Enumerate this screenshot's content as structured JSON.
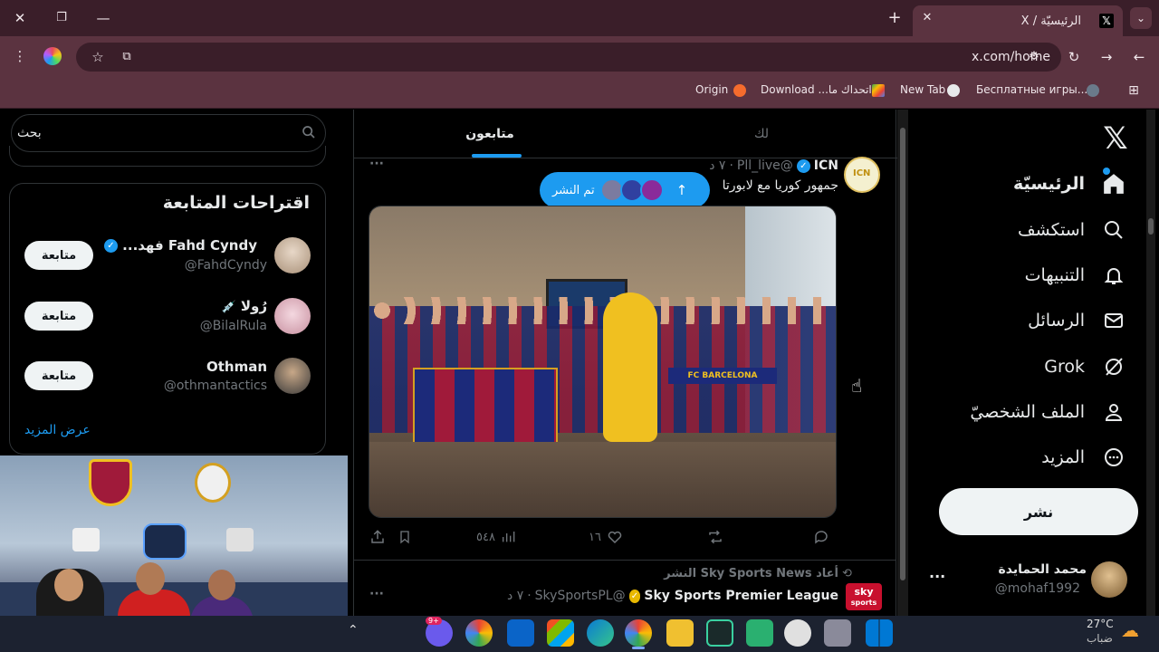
{
  "browser": {
    "tab_title": "الرئيسيّة / X",
    "url": "x.com/home",
    "bookmarks": [
      {
        "label": "Бесплатные игры..."
      },
      {
        "label": "New Tab"
      },
      {
        "label": "اتحداك ما... Download"
      },
      {
        "label": "Origin"
      }
    ]
  },
  "nav": {
    "items": [
      {
        "label": "الرئيسيّة",
        "icon": "home-icon"
      },
      {
        "label": "استكشف",
        "icon": "search-icon"
      },
      {
        "label": "التنبيهات",
        "icon": "bell-icon"
      },
      {
        "label": "الرسائل",
        "icon": "mail-icon"
      },
      {
        "label": "Grok",
        "icon": "grok-icon"
      },
      {
        "label": "الملف الشخصيّ",
        "icon": "person-icon"
      },
      {
        "label": "المزيد",
        "icon": "more-circle-icon"
      }
    ],
    "post_button": "نشر",
    "account_name": "محمد الحمايدة",
    "account_handle": "@mohaf1992"
  },
  "center": {
    "tabs": [
      {
        "label": "لك"
      },
      {
        "label": "متابعون"
      }
    ],
    "new_posts_pill": "تم النشر",
    "tweet1": {
      "author": "ICN",
      "handle": "@Pll_live",
      "time": "٧ د",
      "text": "جمهور كوريا مع لابورتا",
      "image_text": "FC BARCELONA",
      "views": "٥٤٨",
      "likes": "١٦"
    },
    "tweet2": {
      "repost_note": "أعاد Sky Sports News النشر",
      "author": "Sky Sports Premier League",
      "handle": "@SkySportsPL",
      "time": "٧ د",
      "avatar_text_top": "sky",
      "avatar_text_bottom": "sports"
    }
  },
  "right": {
    "search_placeholder": "بحث",
    "follow_title": "اقتراحات المتابعة",
    "suggestions": [
      {
        "name": "Fahd Cyndy فهد...",
        "handle": "@FahdCyndy",
        "button": "متابعة"
      },
      {
        "name": "رُولا",
        "handle": "@BilalRula",
        "button": "متابعة"
      },
      {
        "name": "Othman",
        "handle": "@othmantactics",
        "button": "متابعة"
      }
    ],
    "show_more": "عرض المزيد"
  },
  "taskbar": {
    "temperature": "27°C",
    "weather": "ضباب",
    "badge": "9+"
  },
  "colors": {
    "accent": "#1d9bf0",
    "chrome_tab": "#3a1e29",
    "chrome_bar": "#5b3340"
  }
}
